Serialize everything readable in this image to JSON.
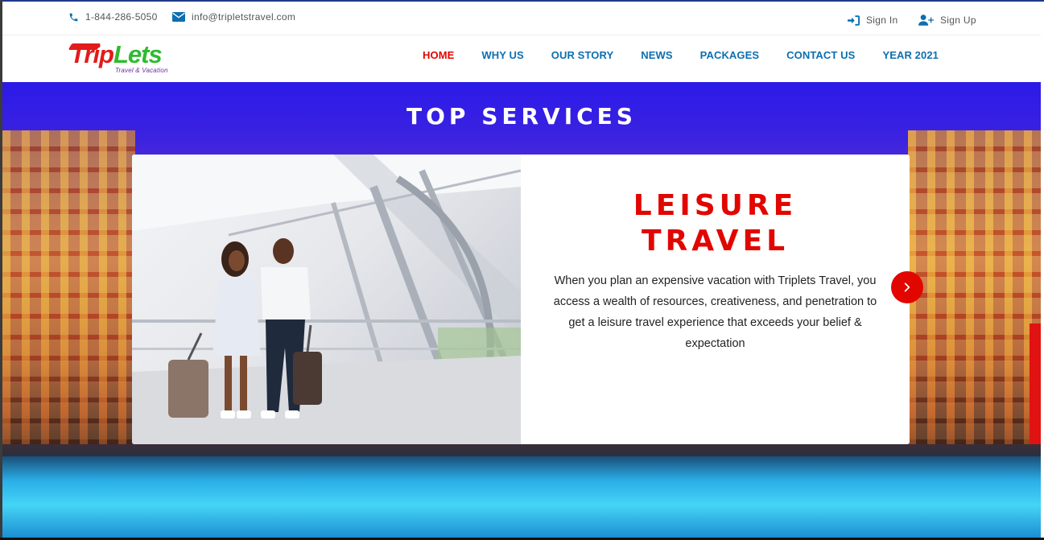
{
  "colors": {
    "accent": "#e10600",
    "nav_link": "#0c6fb0",
    "logo_red": "#e21b1b",
    "logo_green": "#2fbb2f"
  },
  "topbar": {
    "phone": "1-844-286-5050",
    "email": "info@tripletstravel.com",
    "signin": "Sign In",
    "signup": "Sign Up"
  },
  "logo": {
    "part1": "Trip",
    "part2": "Lets",
    "tagline": "Travel & Vacation"
  },
  "nav": {
    "items": [
      {
        "label": "HOME",
        "active": true
      },
      {
        "label": "WHY US"
      },
      {
        "label": "OUR STORY"
      },
      {
        "label": "NEWS"
      },
      {
        "label": "PACKAGES"
      },
      {
        "label": "CONTACT US"
      },
      {
        "label": "YEAR 2021"
      }
    ]
  },
  "hero": {
    "title": "TOP SERVICES",
    "card": {
      "heading_line1": "LEISURE",
      "heading_line2": "TRAVEL",
      "body": "When you plan an expensive vacation with Triplets Travel, you access a wealth of resources, creativeness, and penetration to get a leisure travel experience that exceeds your belief & expectation"
    },
    "next_icon": "chevron-right-icon"
  }
}
